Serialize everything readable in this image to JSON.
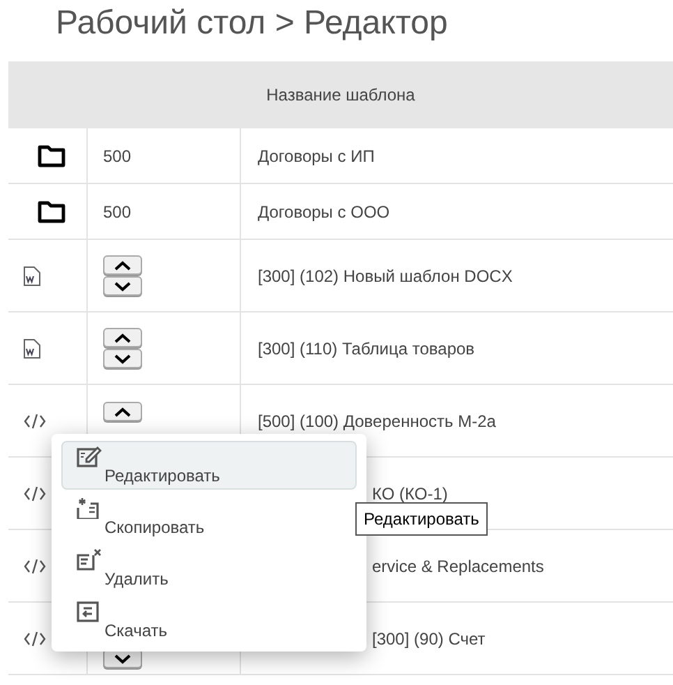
{
  "breadcrumb": "Рабочий стол > Редактор",
  "table": {
    "header": "Название шаблона",
    "rows": [
      {
        "kind": "folder",
        "order": "500",
        "name": "Договоры с ИП"
      },
      {
        "kind": "folder",
        "order": "500",
        "name": "Договоры с ООО"
      },
      {
        "kind": "docx",
        "arrows": [
          {
            "kind": "up"
          },
          {
            "kind": "down"
          }
        ],
        "name": "[300] (102) Новый шаблон DOCX"
      },
      {
        "kind": "docx",
        "arrows": [
          {
            "kind": "up"
          },
          {
            "kind": "down"
          }
        ],
        "name": "[300] (110) Таблица товаров"
      },
      {
        "kind": "code",
        "arrows": [
          {
            "kind": "up"
          }
        ],
        "name": "[500] (100) Доверенность М-2а"
      },
      {
        "kind": "code",
        "name": "КО (КО-1)"
      },
      {
        "kind": "code",
        "name": "ervice & Replacements"
      },
      {
        "kind": "code",
        "arrows": [
          {
            "kind": "down"
          }
        ],
        "name": "[300] (90) Счет"
      }
    ]
  },
  "context_menu": {
    "items": [
      {
        "kind": "edit",
        "label": "Редактировать",
        "selected": true
      },
      {
        "kind": "copy",
        "label": "Скопировать",
        "selected": false
      },
      {
        "kind": "delete",
        "label": "Удалить",
        "selected": false
      },
      {
        "kind": "download",
        "label": "Скачать",
        "selected": false
      }
    ]
  },
  "tooltip": "Редактировать"
}
